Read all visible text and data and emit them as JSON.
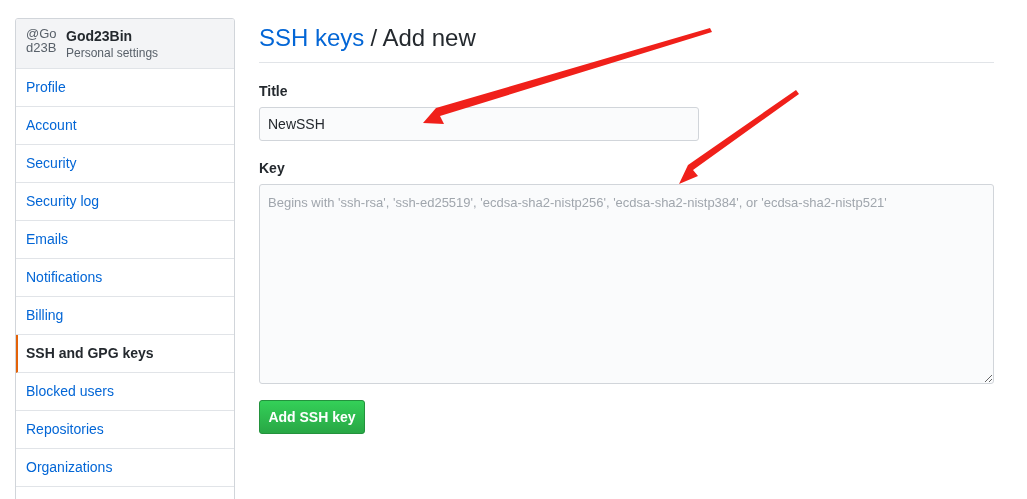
{
  "sidebar": {
    "header": {
      "avatar_alt": "@God23B",
      "username": "God23Bin",
      "subtitle": "Personal settings"
    },
    "items": [
      {
        "label": "Profile",
        "selected": false
      },
      {
        "label": "Account",
        "selected": false
      },
      {
        "label": "Security",
        "selected": false
      },
      {
        "label": "Security log",
        "selected": false
      },
      {
        "label": "Emails",
        "selected": false
      },
      {
        "label": "Notifications",
        "selected": false
      },
      {
        "label": "Billing",
        "selected": false
      },
      {
        "label": "SSH and GPG keys",
        "selected": true
      },
      {
        "label": "Blocked users",
        "selected": false
      },
      {
        "label": "Repositories",
        "selected": false
      },
      {
        "label": "Organizations",
        "selected": false
      }
    ]
  },
  "main": {
    "breadcrumb_link": "SSH keys",
    "heading": "/ Add new",
    "title_field": {
      "label": "Title",
      "value": "NewSSH"
    },
    "key_field": {
      "label": "Key",
      "placeholder": "Begins with 'ssh-rsa', 'ssh-ed25519', 'ecdsa-sha2-nistp256', 'ecdsa-sha2-nistp384', or 'ecdsa-sha2-nistp521'"
    },
    "submit_button": "Add SSH key"
  }
}
